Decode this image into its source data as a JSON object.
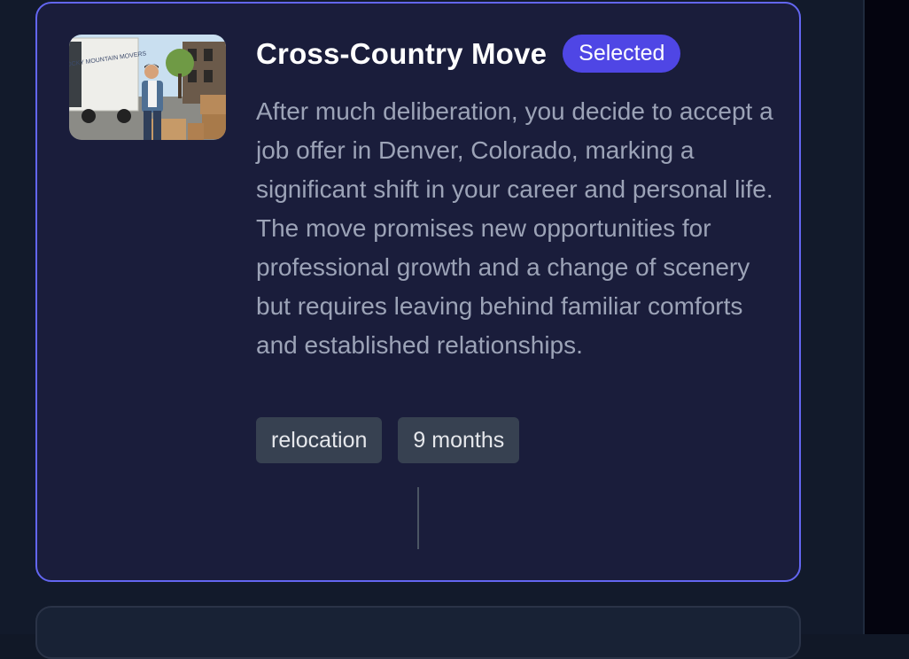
{
  "card": {
    "image_alt": "man with boxes in front of moving truck",
    "truck_text": "ROCKY MOUNTAIN MOVERS",
    "title": "Cross-Country Move",
    "badge": "Selected",
    "description": "After much deliberation, you decide to accept a job offer in Denver, Colorado, marking a significant shift in your career and personal life. The move promises new opportunities for professional growth and a change of scenery but requires leaving behind familiar comforts and established relationships.",
    "tags": [
      "relocation",
      "9 months"
    ]
  },
  "colors": {
    "accent": "#6366f1",
    "badge_bg": "#4f46e5",
    "card_bg": "#1a1d3b",
    "tag_bg": "#374151"
  }
}
